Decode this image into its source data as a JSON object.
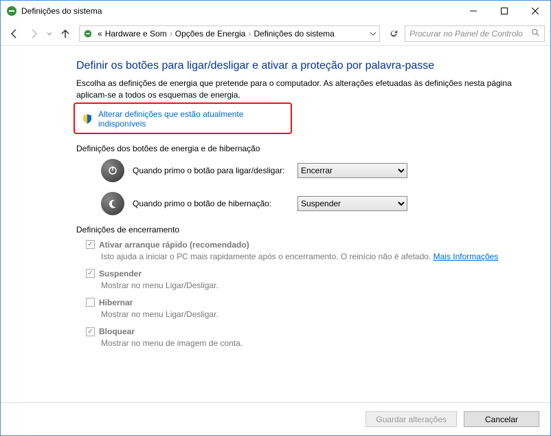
{
  "window": {
    "title": "Definições do sistema"
  },
  "breadcrumb": {
    "prefix": "«",
    "items": [
      "Hardware e Som",
      "Opções de Energia",
      "Definições do sistema"
    ]
  },
  "search": {
    "placeholder": "Procurar no Painel de Controlo"
  },
  "page": {
    "heading": "Definir os botões para ligar/desligar e ativar a proteção por palavra-passe",
    "intro": "Escolha as definições de energia que pretende para o computador. As alterações efetuadas às definições nesta página aplicam-se a todos os esquemas de energia.",
    "unlock_link": "Alterar definições que estão atualmente indisponíveis",
    "section_buttons": "Definições dos botões de energia e de hibernação",
    "power_button_label": "Quando primo o botão para ligar/desligar:",
    "power_button_value": "Encerrar",
    "sleep_button_label": "Quando primo o botão de hibernação:",
    "sleep_button_value": "Suspender",
    "section_shutdown": "Definições de encerramento",
    "shutdown_items": [
      {
        "checked": true,
        "title": "Ativar arranque rápido (recomendado)",
        "desc_a": "Isto ajuda a iniciar o PC mais rapidamente após o encerramento. O reinício não é afetado. ",
        "desc_link": "Mais Informações"
      },
      {
        "checked": true,
        "title": "Suspender",
        "desc_a": "Mostrar no menu Ligar/Desligar.",
        "desc_link": ""
      },
      {
        "checked": false,
        "title": "Hibernar",
        "desc_a": "Mostrar no menu Ligar/Desligar.",
        "desc_link": ""
      },
      {
        "checked": true,
        "title": "Bloquear",
        "desc_a": "Mostrar no menu de imagem de conta.",
        "desc_link": ""
      }
    ]
  },
  "footer": {
    "save": "Guardar alterações",
    "cancel": "Cancelar"
  }
}
